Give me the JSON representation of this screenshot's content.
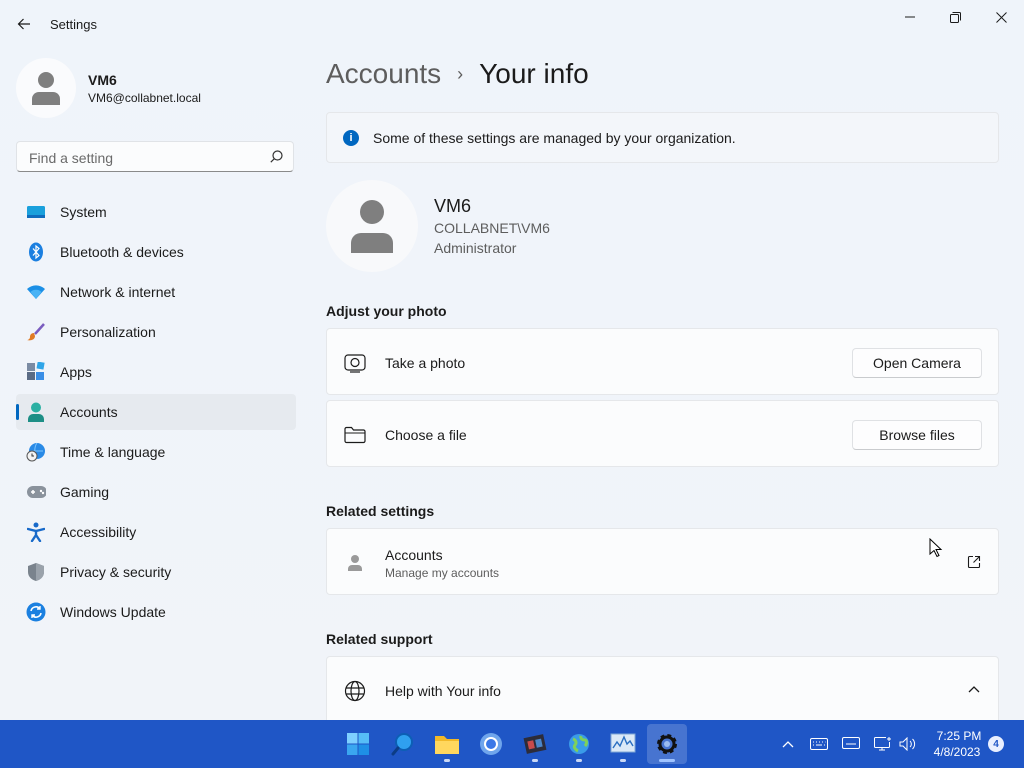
{
  "window": {
    "app_title": "Settings",
    "back_icon": "arrow-left-icon",
    "controls": [
      "minimize-icon",
      "restore-icon",
      "close-icon"
    ]
  },
  "sidebar": {
    "profile": {
      "name": "VM6",
      "email": "VM6@collabnet.local"
    },
    "search": {
      "placeholder": "Find a setting",
      "value": ""
    },
    "items": [
      {
        "label": "System",
        "icon": "system-icon",
        "selected": false
      },
      {
        "label": "Bluetooth & devices",
        "icon": "bluetooth-icon",
        "selected": false
      },
      {
        "label": "Network & internet",
        "icon": "wifi-icon",
        "selected": false
      },
      {
        "label": "Personalization",
        "icon": "brush-icon",
        "selected": false
      },
      {
        "label": "Apps",
        "icon": "apps-icon",
        "selected": false
      },
      {
        "label": "Accounts",
        "icon": "accounts-icon",
        "selected": true
      },
      {
        "label": "Time & language",
        "icon": "globe-clock-icon",
        "selected": false
      },
      {
        "label": "Gaming",
        "icon": "gamepad-icon",
        "selected": false
      },
      {
        "label": "Accessibility",
        "icon": "accessibility-icon",
        "selected": false
      },
      {
        "label": "Privacy & security",
        "icon": "shield-icon",
        "selected": false
      },
      {
        "label": "Windows Update",
        "icon": "update-icon",
        "selected": false
      }
    ]
  },
  "main": {
    "breadcrumb": {
      "parent": "Accounts",
      "separator": "›",
      "current": "Your info"
    },
    "info_banner": {
      "icon": "info-icon",
      "glyph": "i",
      "text": "Some of these settings are managed by your organization."
    },
    "user": {
      "name": "VM6",
      "domain": "COLLABNET\\VM6",
      "role": "Administrator"
    },
    "adjust_photo": {
      "title": "Adjust your photo",
      "take_photo": {
        "label": "Take a photo",
        "button": "Open Camera",
        "icon": "camera-icon"
      },
      "choose_file": {
        "label": "Choose a file",
        "button": "Browse files",
        "icon": "folder-icon"
      }
    },
    "related_settings": {
      "title": "Related settings",
      "accounts": {
        "label": "Accounts",
        "sublabel": "Manage my accounts",
        "icon": "person-icon",
        "action_icon": "open-external-icon"
      }
    },
    "related_support": {
      "title": "Related support",
      "help": {
        "label": "Help with Your info",
        "icon": "globe-icon",
        "expand_icon": "chevron-up-icon"
      }
    }
  },
  "taskbar": {
    "apps": [
      {
        "name": "start",
        "icon": "windows-start-icon"
      },
      {
        "name": "search",
        "icon": "search-taskbar-icon"
      },
      {
        "name": "file-explorer",
        "icon": "file-explorer-icon"
      },
      {
        "name": "chrome",
        "icon": "chrome-icon"
      },
      {
        "name": "media-app",
        "icon": "film-icon"
      },
      {
        "name": "globe-app",
        "icon": "globe-app-icon"
      },
      {
        "name": "monitor-app",
        "icon": "performance-monitor-icon"
      },
      {
        "name": "settings",
        "icon": "settings-gear-icon",
        "active": true
      }
    ],
    "tray": [
      "chevron-up-tray-icon",
      "keyboard-icon",
      "display-icon",
      "network-tray-icon",
      "volume-icon"
    ],
    "time": "7:25 PM",
    "date": "4/8/2023",
    "notification_count": "4"
  }
}
